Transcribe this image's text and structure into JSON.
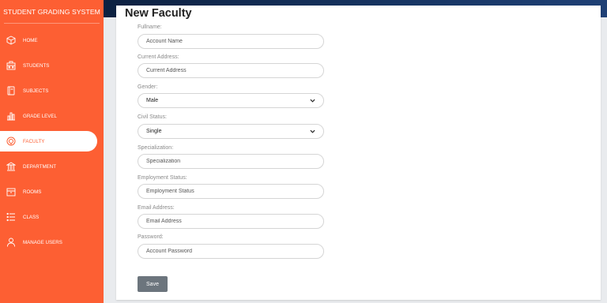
{
  "app": {
    "title": "STUDENT GRADING SYSTEM"
  },
  "sidebar": {
    "items": [
      {
        "label": "HOME",
        "icon": "cube-icon"
      },
      {
        "label": "STUDENTS",
        "icon": "students-icon"
      },
      {
        "label": "SUBJECTS",
        "icon": "book-icon"
      },
      {
        "label": "GRADE LEVEL",
        "icon": "bar-chart-icon"
      },
      {
        "label": "FACULTY",
        "icon": "faculty-icon",
        "active": true
      },
      {
        "label": "DEPARTMENT",
        "icon": "building-icon"
      },
      {
        "label": "ROOMS",
        "icon": "box-icon"
      },
      {
        "label": "CLASS",
        "icon": "list-icon"
      },
      {
        "label": "MANAGE USERS",
        "icon": "user-icon"
      }
    ]
  },
  "form": {
    "title": "New Faculty",
    "fullname": {
      "label": "Fullname:",
      "placeholder": "Account Name"
    },
    "address": {
      "label": "Current Address:",
      "placeholder": "Current Address"
    },
    "gender": {
      "label": "Gender:",
      "value": "Male"
    },
    "civil_status": {
      "label": "Civil Status:",
      "value": "Single"
    },
    "specialization": {
      "label": "Specialization:",
      "placeholder": "Specialization"
    },
    "employment": {
      "label": "Employment Status:",
      "placeholder": "Employment Status"
    },
    "email": {
      "label": "Email Address:",
      "placeholder": "Email Address"
    },
    "password": {
      "label": "Password:",
      "placeholder": "Account Password"
    },
    "save_label": "Save"
  },
  "colors": {
    "sidebar_bg": "#fd5f33",
    "topbar": "#0d2141",
    "button": "#6c757d"
  }
}
